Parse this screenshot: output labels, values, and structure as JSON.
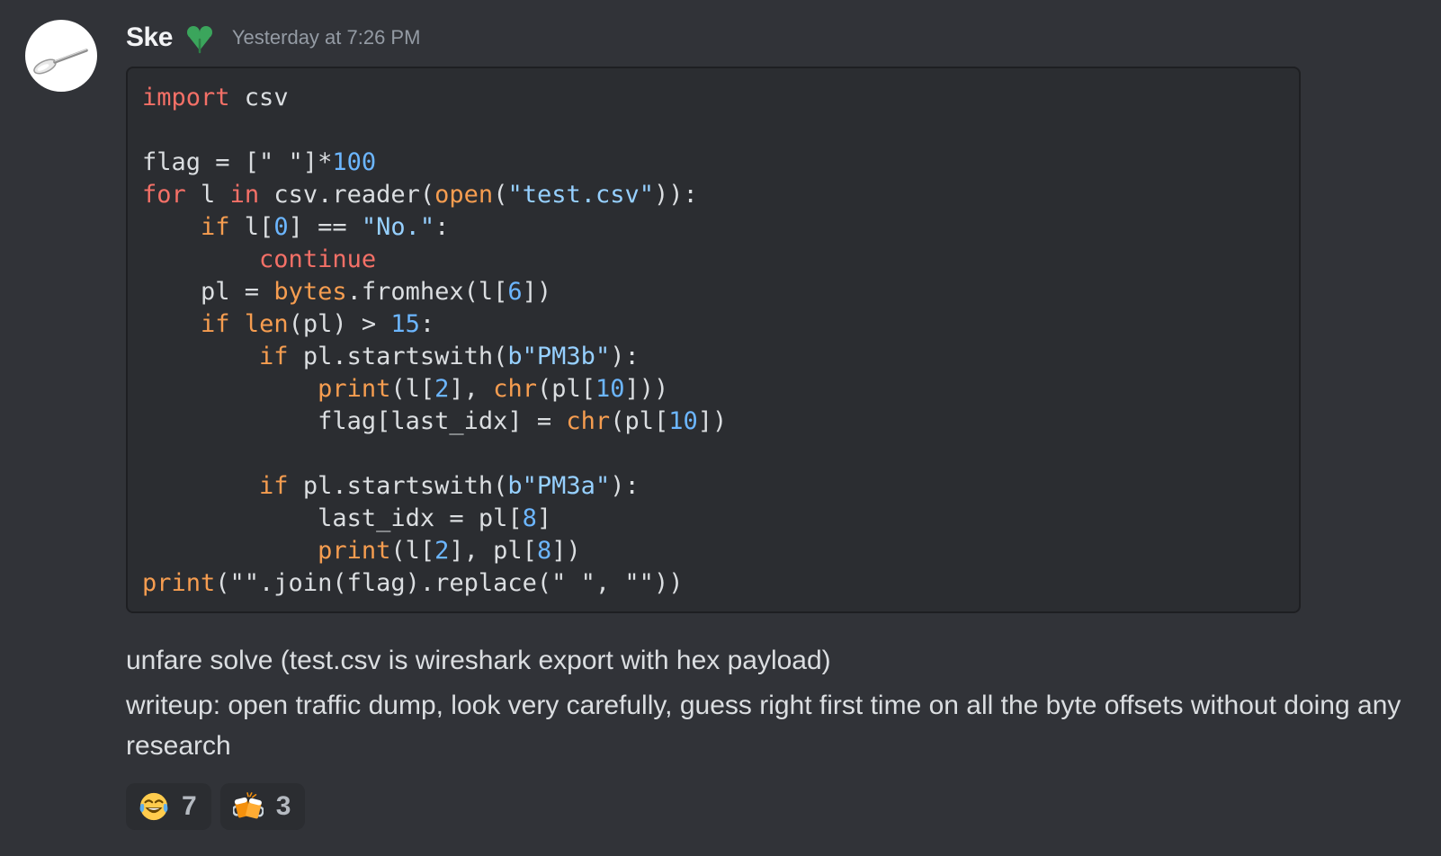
{
  "message": {
    "username": "Ske",
    "timestamp": "Yesterday at 7:26 PM",
    "code_lines": [
      [
        {
          "t": "import",
          "c": "kw"
        },
        {
          "t": " csv"
        }
      ],
      [],
      [
        {
          "t": "flag = [\" \"]*"
        },
        {
          "t": "100",
          "c": "num"
        }
      ],
      [
        {
          "t": "for",
          "c": "kw"
        },
        {
          "t": " l "
        },
        {
          "t": "in",
          "c": "kw"
        },
        {
          "t": " csv.reader("
        },
        {
          "t": "open",
          "c": "bi"
        },
        {
          "t": "("
        },
        {
          "t": "\"test.csv\"",
          "c": "str"
        },
        {
          "t": ")):"
        }
      ],
      [
        {
          "t": "    "
        },
        {
          "t": "if",
          "c": "bi"
        },
        {
          "t": " l["
        },
        {
          "t": "0",
          "c": "num"
        },
        {
          "t": "] == "
        },
        {
          "t": "\"No.\"",
          "c": "str"
        },
        {
          "t": ":"
        }
      ],
      [
        {
          "t": "        "
        },
        {
          "t": "continue",
          "c": "kw"
        }
      ],
      [
        {
          "t": "    pl = "
        },
        {
          "t": "bytes",
          "c": "bi"
        },
        {
          "t": ".fromhex(l["
        },
        {
          "t": "6",
          "c": "num"
        },
        {
          "t": "])"
        }
      ],
      [
        {
          "t": "    "
        },
        {
          "t": "if",
          "c": "bi"
        },
        {
          "t": " "
        },
        {
          "t": "len",
          "c": "bi"
        },
        {
          "t": "(pl) > "
        },
        {
          "t": "15",
          "c": "num"
        },
        {
          "t": ":"
        }
      ],
      [
        {
          "t": "        "
        },
        {
          "t": "if",
          "c": "bi"
        },
        {
          "t": " pl.startswith("
        },
        {
          "t": "b\"PM3b\"",
          "c": "str"
        },
        {
          "t": "):"
        }
      ],
      [
        {
          "t": "            "
        },
        {
          "t": "print",
          "c": "bi"
        },
        {
          "t": "(l["
        },
        {
          "t": "2",
          "c": "num"
        },
        {
          "t": "], "
        },
        {
          "t": "chr",
          "c": "bi"
        },
        {
          "t": "(pl["
        },
        {
          "t": "10",
          "c": "num"
        },
        {
          "t": "]))"
        }
      ],
      [
        {
          "t": "            flag[last_idx] = "
        },
        {
          "t": "chr",
          "c": "bi"
        },
        {
          "t": "(pl["
        },
        {
          "t": "10",
          "c": "num"
        },
        {
          "t": "])"
        }
      ],
      [],
      [
        {
          "t": "        "
        },
        {
          "t": "if",
          "c": "bi"
        },
        {
          "t": " pl.startswith("
        },
        {
          "t": "b\"PM3a\"",
          "c": "str"
        },
        {
          "t": "):"
        }
      ],
      [
        {
          "t": "            last_idx = pl["
        },
        {
          "t": "8",
          "c": "num"
        },
        {
          "t": "]"
        }
      ],
      [
        {
          "t": "            "
        },
        {
          "t": "print",
          "c": "bi"
        },
        {
          "t": "(l["
        },
        {
          "t": "2",
          "c": "num"
        },
        {
          "t": "], pl["
        },
        {
          "t": "8",
          "c": "num"
        },
        {
          "t": "])"
        }
      ],
      [
        {
          "t": "print",
          "c": "bi"
        },
        {
          "t": "(\"\".join(flag).replace(\" \", \"\"))"
        }
      ]
    ],
    "text_1": "unfare solve (test.csv is wireshark export with hex payload)",
    "text_2": "writeup: open traffic dump, look very carefully, guess right first time on all the byte offsets without doing any research"
  },
  "reactions": [
    {
      "emoji": "joy-emoji",
      "count": "7"
    },
    {
      "emoji": "beers-emoji",
      "count": "3"
    }
  ],
  "colors": {
    "background": "#313338",
    "code_background": "#2b2d31",
    "keyword": "#f47067",
    "builtin": "#f69d50",
    "number": "#6cb6ff",
    "string": "#96d0ff",
    "role_icon": "#3ba55c"
  }
}
